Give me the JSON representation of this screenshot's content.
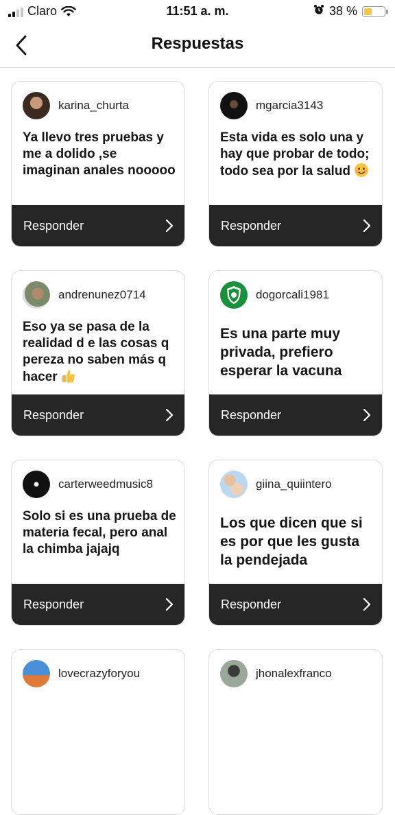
{
  "status_bar": {
    "carrier": "Claro",
    "time": "11:51 a. m.",
    "battery_percent": "38 %",
    "battery_level": 0.38
  },
  "header": {
    "title": "Respuestas",
    "back_icon": "chevron-left-icon"
  },
  "cards": [
    {
      "username": "karina_churta",
      "comment": "Ya llevo tres pruebas y me a dolido ,se imaginan anales nooooo",
      "reply_label": "Responder"
    },
    {
      "username": "mgarcia3143",
      "comment": "Esta vida es solo una y hay que probar de todo; todo sea por la salud",
      "emoji": "smiling-face",
      "reply_label": "Responder"
    },
    {
      "username": "andrenunez0714",
      "comment": "Eso ya  se pasa de la realidad d e las cosas q pereza no saben más q hacer",
      "emoji": "thumbs-up",
      "reply_label": "Responder"
    },
    {
      "username": "dogorcali1981",
      "comment": "Es una parte muy privada, prefiero esperar la vacuna",
      "reply_label": "Responder"
    },
    {
      "username": "carterweedmusic8",
      "comment": "Solo si es una prueba de materia fecal, pero anal la chimba jajajq",
      "reply_label": "Responder"
    },
    {
      "username": "giina_quiintero",
      "comment": "Los que dicen que si es por que les gusta la pendejada",
      "reply_label": "Responder"
    },
    {
      "username": "lovecrazyforyou"
    },
    {
      "username": "jhonalexfranco"
    }
  ]
}
